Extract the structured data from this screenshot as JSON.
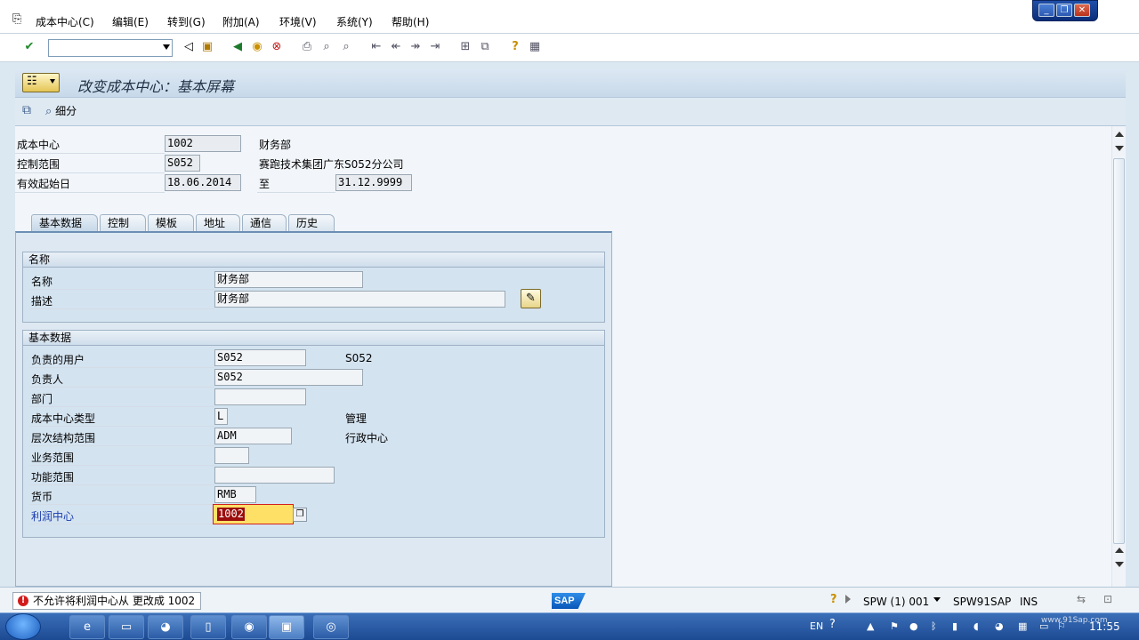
{
  "menubar": {
    "items": [
      "成本中心(C)",
      "编辑(E)",
      "转到(G)",
      "附加(A)",
      "环境(V)",
      "系统(Y)",
      "帮助(H)"
    ]
  },
  "window_controls": {
    "minimize": "_",
    "restore": "❐",
    "close": "✕"
  },
  "toolbar": {
    "command_value": ""
  },
  "title": "改变成本中心：基本屏幕",
  "appbar": {
    "detail_label": "细分"
  },
  "header": {
    "cost_center_label": "成本中心",
    "cost_center_value": "1002",
    "cost_center_text": "财务部",
    "controlling_area_label": "控制范围",
    "controlling_area_value": "S052",
    "controlling_area_text": "赛跑技术集团广东S052分公司",
    "valid_from_label": "有效起始日",
    "valid_from_value": "18.06.2014",
    "to_label": "至",
    "valid_to_value": "31.12.9999"
  },
  "tabs": [
    "基本数据",
    "控制",
    "模板",
    "地址",
    "通信",
    "历史"
  ],
  "group_names": {
    "title": "名称",
    "name_label": "名称",
    "name_value": "财务部",
    "desc_label": "描述",
    "desc_value": "财务部"
  },
  "group_basic": {
    "title": "基本数据",
    "user_resp_label": "负责的用户",
    "user_resp_value": "S052",
    "user_resp_text": "S052",
    "person_resp_label": "负责人",
    "person_resp_value": "S052",
    "dept_label": "部门",
    "dept_value": "",
    "cc_type_label": "成本中心类型",
    "cc_type_value": "L",
    "cc_type_text": "管理",
    "hierarchy_label": "层次结构范围",
    "hierarchy_value": "ADM",
    "hierarchy_text": "行政中心",
    "business_area_label": "业务范围",
    "business_area_value": "",
    "functional_area_label": "功能范围",
    "functional_area_value": "",
    "currency_label": "货币",
    "currency_value": "RMB",
    "profit_center_label": "利润中心",
    "profit_center_value": "1002"
  },
  "statusbar": {
    "message": "不允许将利润中心从  更改成 1002",
    "sap_logo": "SAP",
    "system": "SPW (1) 001",
    "server": "SPW91SAP",
    "mode": "INS"
  },
  "taskbar": {
    "lang": "EN",
    "time": "11:55",
    "watermark": "www.91Sap.com"
  },
  "colors": {
    "error_red": "#d21c1c",
    "profit_center_highlight": "#ffe066",
    "profit_center_selected": "#9c0d0d",
    "link_blue": "#1a3cb0"
  }
}
